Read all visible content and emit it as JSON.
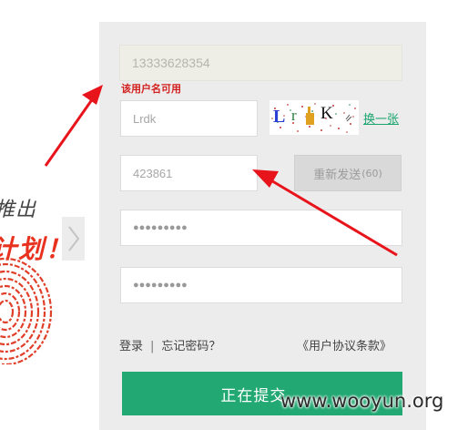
{
  "banner": {
    "line1": "推出",
    "line2": "计划！"
  },
  "form": {
    "phone_value": "13333628354",
    "username_hint": "该用户名可用",
    "captcha_value": "Lrdk",
    "captcha_text": "Lr K",
    "refresh_captcha_label": "换一张",
    "sms_code_value": "423861",
    "resend_label": "重新发送",
    "resend_count": "(60)",
    "password_mask": "●●●●●●●●●",
    "confirm_password_mask": "●●●●●●●●●",
    "login_link": "登录",
    "separator": "|",
    "forgot_password_link": "忘记密码？",
    "agreement_link": "《用户协议条款》",
    "submit_label": "正在提交..."
  },
  "watermark": "www.wooyun.org",
  "colors": {
    "accent_green": "#22a872",
    "hint_red": "#d31e1e",
    "arrow_red": "#e8141b"
  },
  "icons": {
    "slider_next": "chevron-right-icon",
    "fingerprint": "fingerprint-icon"
  }
}
